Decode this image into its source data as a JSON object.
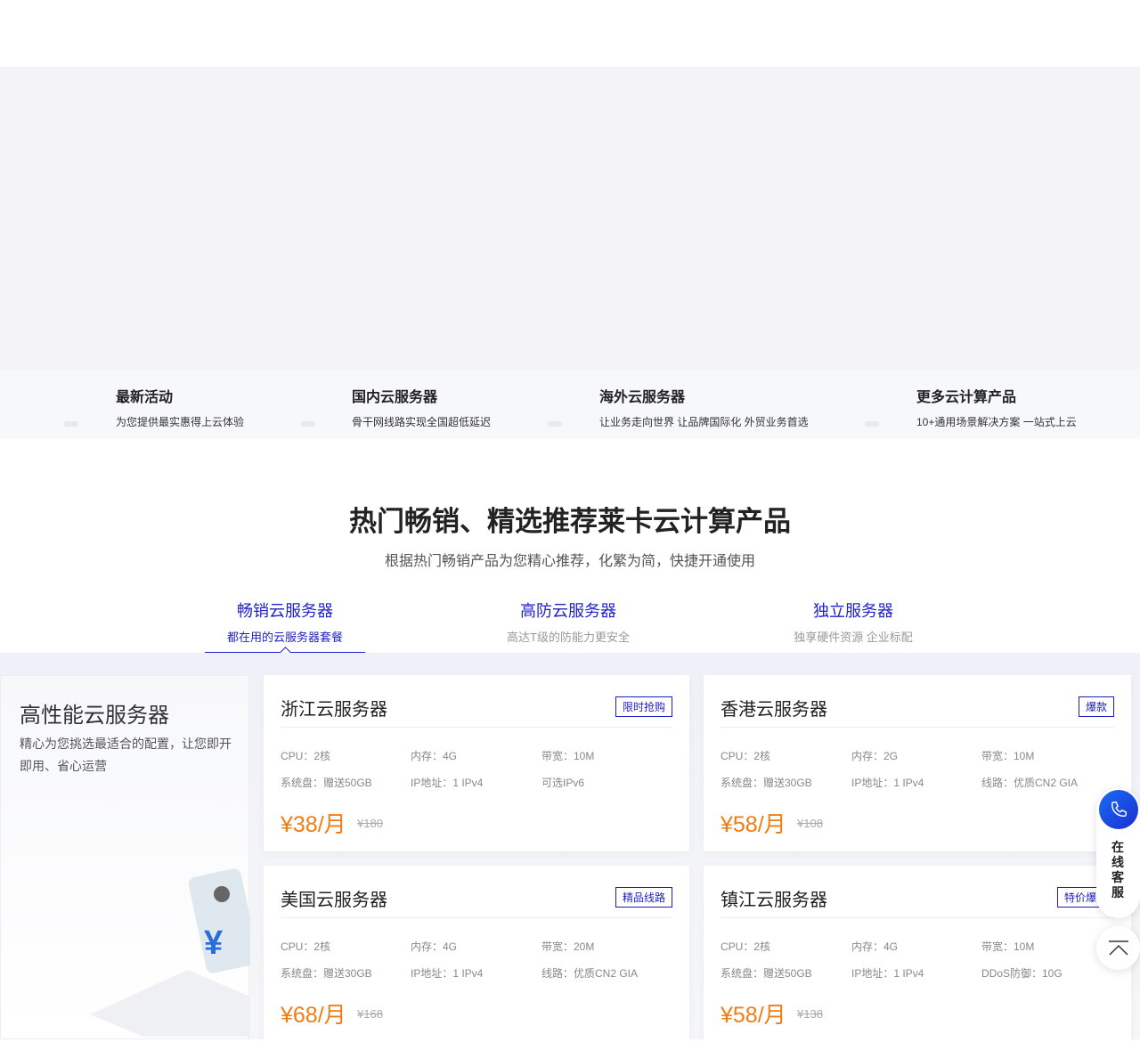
{
  "quick_links": [
    {
      "title": "最新活动",
      "desc": "为您提供最实惠得上云体验"
    },
    {
      "title": "国内云服务器",
      "desc": "骨干网线路实现全国超低延迟"
    },
    {
      "title": "海外云服务器",
      "desc": "让业务走向世界 让品牌国际化 外贸业务首选"
    },
    {
      "title": "更多云计算产品",
      "desc": "10+通用场景解决方案 一站式上云"
    }
  ],
  "section": {
    "title": "热门畅销、精选推荐莱卡云计算产品",
    "subtitle": "根据热门畅销产品为您精心推荐，化繁为简，快捷开通使用"
  },
  "tabs": [
    {
      "title": "畅销云服务器",
      "desc": "都在用的云服务器套餐",
      "active": true
    },
    {
      "title": "高防云服务器",
      "desc": "高达T级的防能力更安全"
    },
    {
      "title": "独立服务器",
      "desc": "独享硬件资源 企业标配"
    }
  ],
  "promo": {
    "title": "高性能云服务器",
    "desc": "精心为您挑选最适合的配置，让您即开即用、省心运营"
  },
  "cards": [
    {
      "title": "浙江云服务器",
      "tag": "限时抢购",
      "specs": [
        "CPU：2核",
        "内存：4G",
        "带宽：10M",
        "系统盘：赠送50GB",
        "IP地址：1 IPv4",
        "可选IPv6"
      ],
      "price": "¥38/月",
      "old_price": "¥180"
    },
    {
      "title": "香港云服务器",
      "tag": "爆款",
      "specs": [
        "CPU：2核",
        "内存：2G",
        "带宽：10M",
        "系统盘：赠送30GB",
        "IP地址：1 IPv4",
        "线路：优质CN2 GIA"
      ],
      "price": "¥58/月",
      "old_price": "¥108"
    },
    {
      "title": "美国云服务器",
      "tag": "精品线路",
      "specs": [
        "CPU：2核",
        "内存：4G",
        "带宽：20M",
        "系统盘：赠送30GB",
        "IP地址：1 IPv4",
        "线路：优质CN2 GIA"
      ],
      "price": "¥68/月",
      "old_price": "¥168"
    },
    {
      "title": "镇江云服务器",
      "tag": "特价爆款",
      "specs": [
        "CPU：2核",
        "内存：4G",
        "带宽：10M",
        "系统盘：赠送50GB",
        "IP地址：1 IPv4",
        "DDoS防御：10G"
      ],
      "price": "¥58/月",
      "old_price": "¥138"
    }
  ],
  "float": {
    "service_label": "在线客服"
  }
}
